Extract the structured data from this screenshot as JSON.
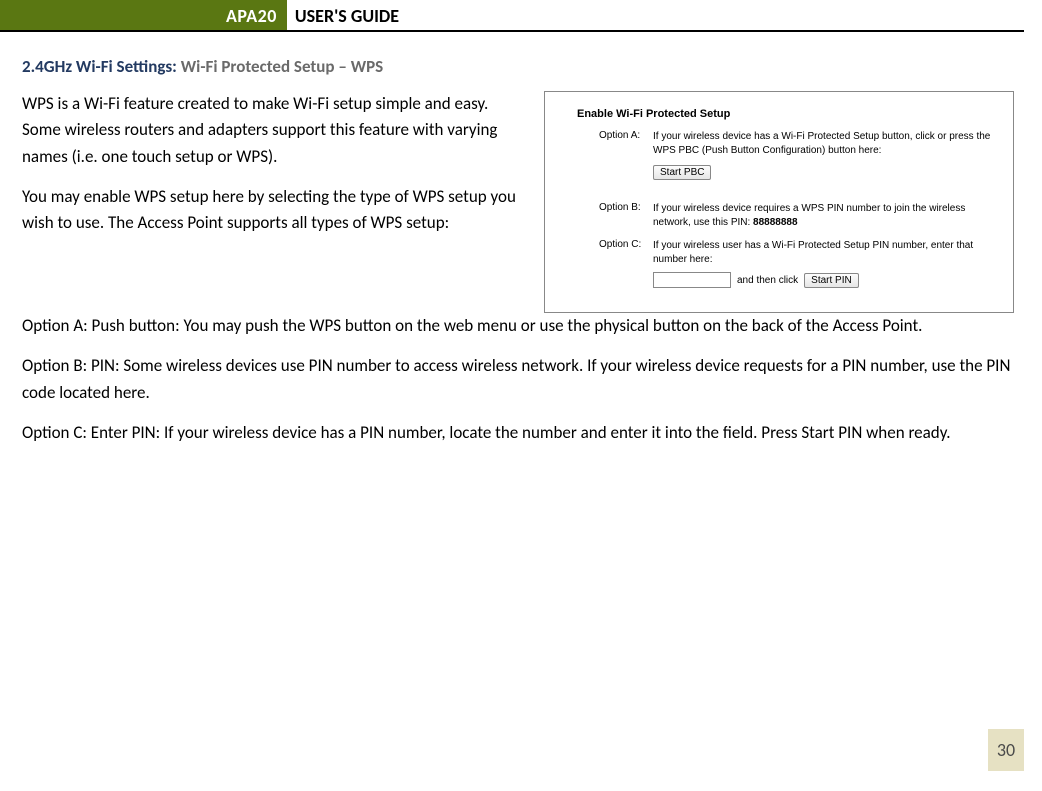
{
  "header": {
    "badge": "APA20",
    "title": "USER'S GUIDE"
  },
  "section": {
    "heading_bold": "2.4GHz Wi-Fi Settings: ",
    "heading_gray": "Wi-Fi Protected Setup – WPS"
  },
  "intro": {
    "p1": "WPS is a Wi-Fi feature created to make Wi-Fi setup simple and easy. Some wireless routers and adapters support this feature with varying names (i.e. one touch setup or WPS).",
    "p2": "You may enable WPS setup here by selecting the type of WPS setup you wish to use. The Access Point supports all types of WPS setup:"
  },
  "body": {
    "optA": "Option A: Push button: You may push the WPS button on the web menu or use the physical button on the back of the Access Point.",
    "optB": "Option B: PIN: Some wireless devices use PIN number to access wireless network. If your wireless device requests for a PIN number, use the PIN code located here.",
    "optC": "Option C: Enter PIN: If your wireless device has a PIN number, locate the number and enter it into the field. Press Start PIN when ready."
  },
  "panel": {
    "title": "Enable Wi-Fi Protected Setup",
    "optA_label": "Option A:",
    "optA_text": "If your wireless device has a Wi-Fi Protected Setup button, click or press the WPS PBC (Push Button Configuration) button here:",
    "btn_pbc": "Start PBC",
    "optB_label": "Option B:",
    "optB_text_pre": "If your wireless device requires a WPS PIN number to join the wireless network, use this PIN: ",
    "optB_pin": "88888888",
    "optC_label": "Option C:",
    "optC_text": "If your wireless user has a Wi-Fi Protected Setup PIN number, enter that number here:",
    "and_then_click": "and then click",
    "btn_pin": "Start PIN"
  },
  "page_number": "30"
}
